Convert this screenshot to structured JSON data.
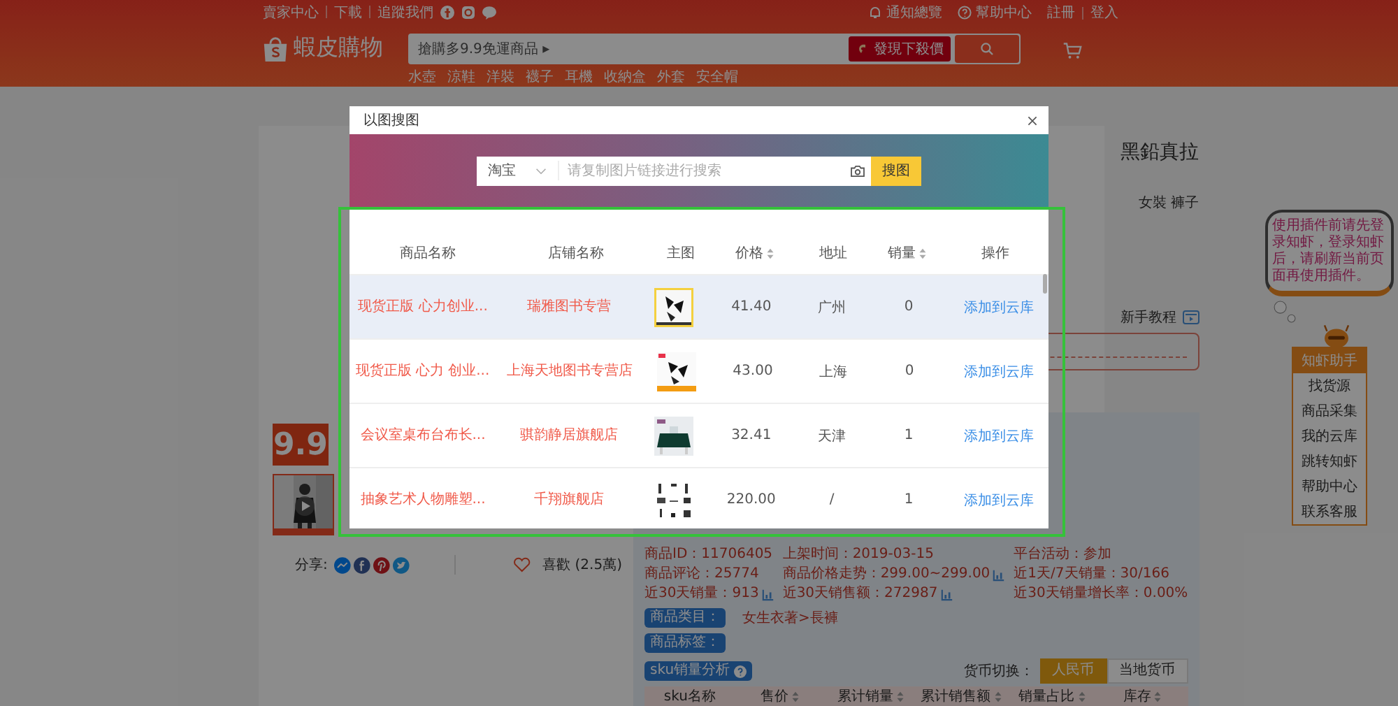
{
  "top_bar": {
    "left_links": [
      "賣家中心",
      "下載",
      "追蹤我們"
    ],
    "right_links": [
      "通知總覽",
      "幫助中心"
    ],
    "auth_links": [
      "註冊",
      "登入"
    ]
  },
  "header": {
    "logo_text": "蝦皮購物",
    "search": {
      "placeholder": "搶購多9.9免運商品 ▸"
    },
    "promo_button": "發現下殺價",
    "keywords": [
      "水壺",
      "涼鞋",
      "洋裝",
      "襪子",
      "耳機",
      "收納盒",
      "外套",
      "安全帽"
    ]
  },
  "product": {
    "badge": "9.9",
    "share_label": "分享:",
    "likes": "喜歡 (2.5萬)",
    "title_fragment": "黑鉛真拉",
    "category_fragment": "女裝 褲子",
    "tutorial_link": "新手教程",
    "stats": [
      {
        "text": "商品ID：11706405",
        "trend": false
      },
      {
        "text": "上架时间：2019-03-15",
        "trend": false
      },
      {
        "text": "平台活动：参加",
        "trend": false
      },
      {
        "text": "商品评论：25774",
        "trend": false
      },
      {
        "text": "商品价格走势：299.00~299.00",
        "trend": true
      },
      {
        "text": "近1天/7天销量：30/166",
        "trend": false
      },
      {
        "text": "近30天销量：913",
        "trend": true
      },
      {
        "text": "近30天销售额：272987",
        "trend": true
      },
      {
        "text": "近30天销量增长率：0.00%",
        "trend": false
      }
    ],
    "category_label": "商品类目：",
    "category_value": "女生衣著>長褲",
    "tags_label": "商品标签：",
    "sku_button": "sku销量分析",
    "currency_label": "货币切换：",
    "currency_options": [
      {
        "label": "人民币",
        "selected": true
      },
      {
        "label": "当地货币",
        "selected": false
      }
    ],
    "sku_columns": [
      {
        "label": "sku名称",
        "sortable": false
      },
      {
        "label": "售价",
        "sortable": true
      },
      {
        "label": "累计销量",
        "sortable": true
      },
      {
        "label": "累计销售额",
        "sortable": true
      },
      {
        "label": "销量占比",
        "sortable": true
      },
      {
        "label": "库存",
        "sortable": true
      }
    ]
  },
  "assistant": {
    "bubble": "使用插件前请先登录知虾，登录知虾后，请刷新当前页面再使用插件。",
    "title": "知虾助手",
    "items": [
      "找货源",
      "商品采集",
      "我的云库",
      "跳转知虾",
      "帮助中心",
      "联系客服"
    ]
  },
  "modal": {
    "title": "以图搜图",
    "platform": "淘宝",
    "placeholder": "请复制图片链接进行搜索",
    "search_button": "搜图",
    "columns": [
      {
        "label": "商品名称",
        "sortable": false
      },
      {
        "label": "店铺名称",
        "sortable": false
      },
      {
        "label": "主图",
        "sortable": false
      },
      {
        "label": "价格",
        "sortable": true
      },
      {
        "label": "地址",
        "sortable": false
      },
      {
        "label": "销量",
        "sortable": true
      },
      {
        "label": "操作",
        "sortable": false
      }
    ],
    "rows": [
      {
        "name": "现货正版 心力创业...",
        "shop": "瑞雅图书专营",
        "price": "41.40",
        "address": "广州",
        "sales": "0",
        "action": "添加到云库",
        "selected": true
      },
      {
        "name": "现货正版 心力 创业...",
        "shop": "上海天地图书专营店",
        "price": "43.00",
        "address": "上海",
        "sales": "0",
        "action": "添加到云库",
        "selected": false
      },
      {
        "name": "会议室桌布台布长...",
        "shop": "骐韵静居旗舰店",
        "price": "32.41",
        "address": "天津",
        "sales": "1",
        "action": "添加到云库",
        "selected": false
      },
      {
        "name": "抽象艺术人物雕塑...",
        "shop": "千翔旗舰店",
        "price": "220.00",
        "address": "/",
        "sales": "1",
        "action": "添加到云库",
        "selected": false
      }
    ]
  }
}
